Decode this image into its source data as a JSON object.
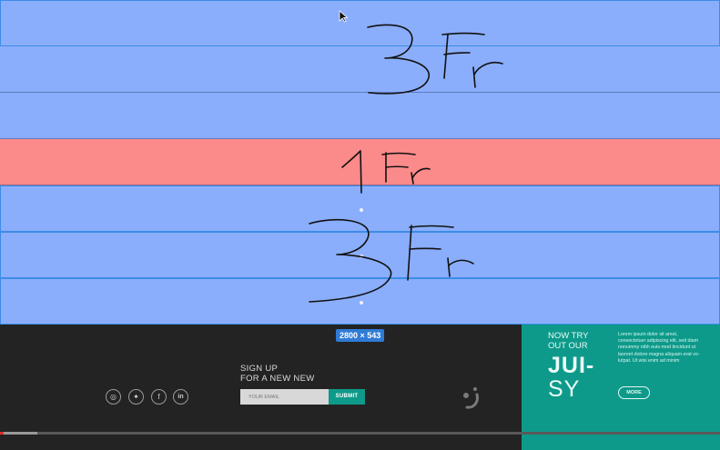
{
  "grid_overlay": {
    "rows": [
      {
        "color": "blue",
        "selected": true
      },
      {
        "color": "blue",
        "selected": false
      },
      {
        "color": "blue",
        "selected": false
      },
      {
        "color": "red",
        "selected": false
      },
      {
        "color": "blue",
        "selected": true
      },
      {
        "color": "blue",
        "selected": true
      },
      {
        "color": "blue",
        "selected": true
      }
    ],
    "annotations": [
      "3Fr",
      "1Fr",
      "3Fr"
    ],
    "colors": {
      "blue": "#8aaefc",
      "red": "#fb8a8a",
      "selection": "#3c8ce6"
    }
  },
  "size_badge": "2800 × 543",
  "footer": {
    "social_icons": [
      "instagram-icon",
      "twitter-icon",
      "facebook-icon",
      "linkedin-icon"
    ],
    "signup": {
      "line1": "SIGN UP",
      "line2": "FOR A NEW NEW",
      "email_placeholder": "YOUR EMAIL",
      "submit_label": "SUBMIT"
    },
    "promo": {
      "heading_line1": "NOW TRY",
      "heading_line2": "OUT OUR",
      "big_line1": "JUI-",
      "big_line2": "SY",
      "body": "Lorem ipsum dolor sit amet, consectetuer adipiscing elit, sed diam nonummy nibh euis-mod tincidunt ut laoreet dolore magna aliquam erat vo-lutpat. Ut wisi enim ad minim",
      "more_label": "MORE"
    },
    "colors": {
      "dark": "#232323",
      "teal": "#0e9a8a"
    }
  },
  "video_progress": {
    "fraction": 0.052
  }
}
